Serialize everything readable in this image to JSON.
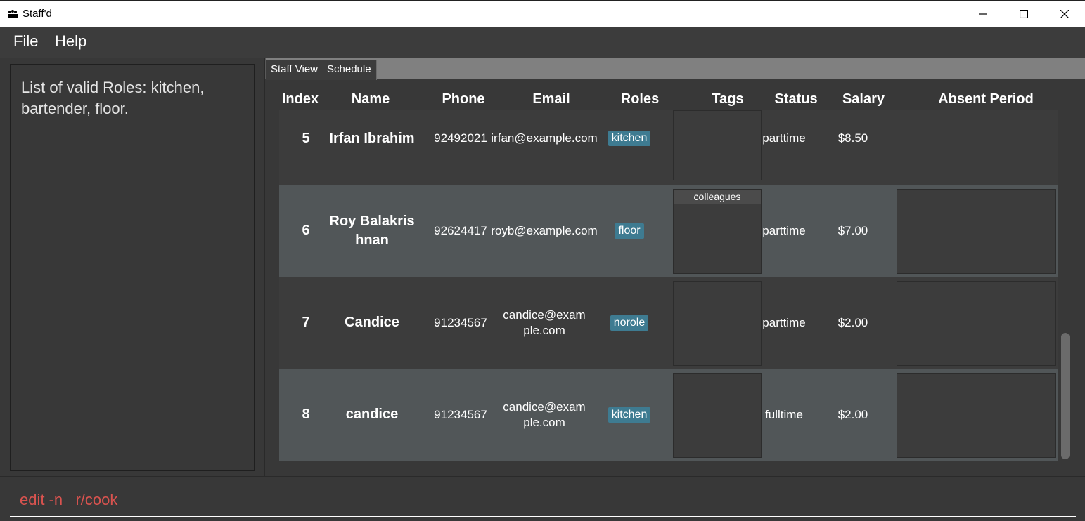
{
  "window": {
    "title": "Staff'd"
  },
  "menu": {
    "file": "File",
    "help": "Help"
  },
  "result": {
    "text": "List of valid Roles: kitchen, bartender, floor."
  },
  "tabs": [
    "Staff View",
    "Schedule"
  ],
  "columns": {
    "index": "Index",
    "name": "Name",
    "phone": "Phone",
    "email": "Email",
    "roles": "Roles",
    "tags": "Tags",
    "status": "Status",
    "salary": "Salary",
    "absent": "Absent Period"
  },
  "rows": [
    {
      "index": "5",
      "name": "Irfan Ibrahim",
      "phone": "92492021",
      "email": "irfan@example.com",
      "role": "kitchen",
      "tag": "",
      "status": "parttime",
      "salary": "$8.50"
    },
    {
      "index": "6",
      "name": "Roy Balakrishnan",
      "phone": "92624417",
      "email": "royb@example.com",
      "role": "floor",
      "tag": "colleagues",
      "status": "parttime",
      "salary": "$7.00"
    },
    {
      "index": "7",
      "name": "Candice",
      "phone": "91234567",
      "email": "candice@example.com",
      "role": "norole",
      "tag": "",
      "status": "parttime",
      "salary": "$2.00"
    },
    {
      "index": "8",
      "name": "candice",
      "phone": "91234567",
      "email": "candice@example.com",
      "role": "kitchen",
      "tag": "",
      "status": "fulltime",
      "salary": "$2.00"
    }
  ],
  "command": {
    "text": "edit -n   r/cook"
  },
  "colors": {
    "role_badge": "#3e7b91",
    "command_text": "#d9534f",
    "row_light": "#515658",
    "row_dark": "#3c3c3c"
  }
}
